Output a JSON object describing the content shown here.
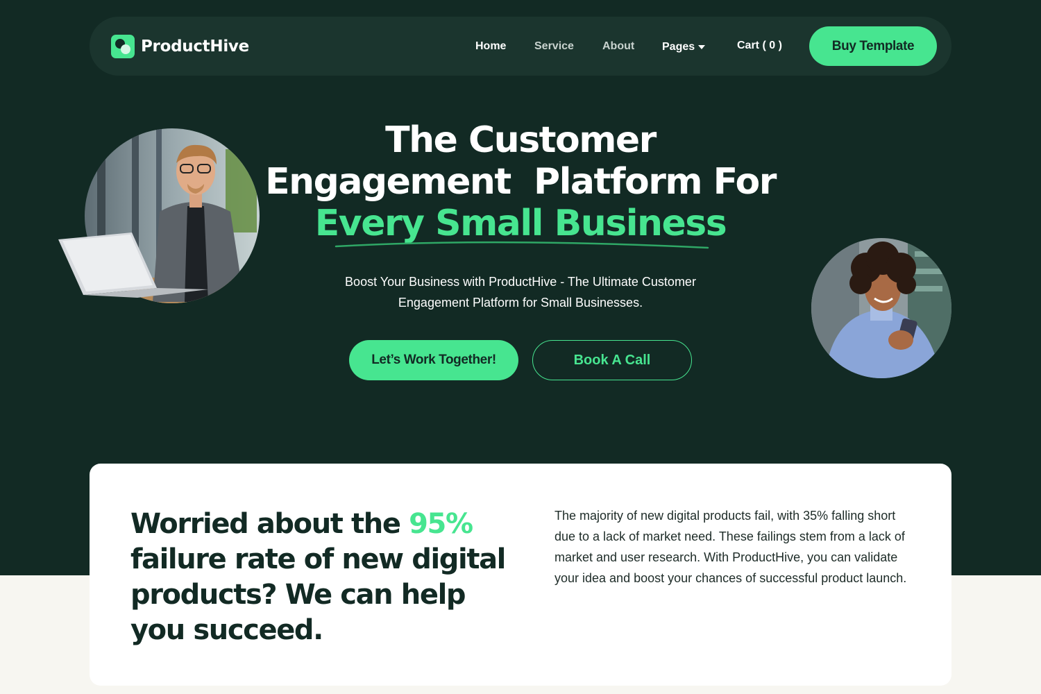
{
  "brand": {
    "name": "ProductHive",
    "accent": "#47e590",
    "dark": "#122a24"
  },
  "nav": {
    "home": "Home",
    "service": "Service",
    "about": "About",
    "pages": "Pages",
    "cart": "Cart ( 0 )",
    "buy": "Buy Template"
  },
  "hero": {
    "line1": "The Customer",
    "line2": "Engagement  Platform For",
    "line3": "Every Small Business",
    "sub1": "Boost Your Business with ProductHive - The Ultimate Customer",
    "sub2": "Engagement Platform for Small Businesses.",
    "cta_primary": "Let’s Work Together!",
    "cta_secondary": "Book A Call"
  },
  "card": {
    "title_pre": "Worried about the ",
    "title_highlight": "95%",
    "title_post": " failure rate of new digital products? We can help you succeed.",
    "body": "The majority of new digital products fail, with 35% falling short due to a lack of market need. These failings stem from a lack of market and user research. With ProductHive, you can validate your idea and boost your chances of successful product launch."
  }
}
